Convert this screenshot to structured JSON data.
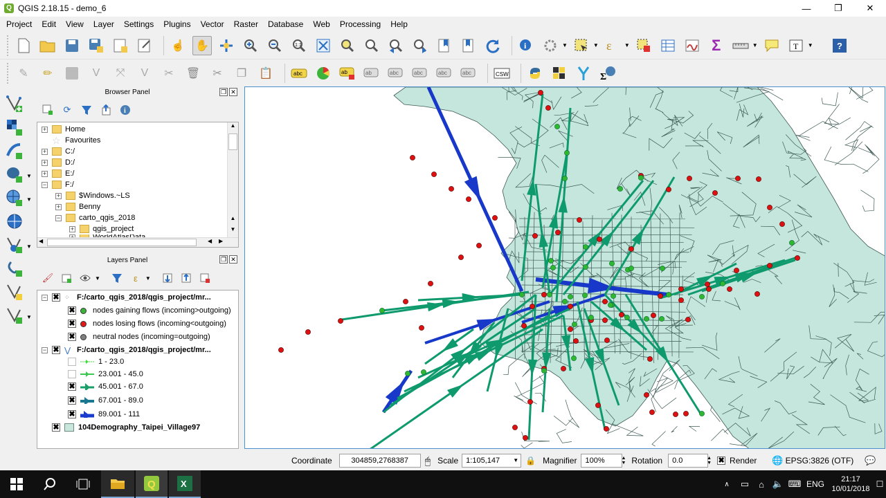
{
  "window": {
    "title": "QGIS 2.18.15 - demo_6",
    "minimize_glyph": "—",
    "maximize_glyph": "❐",
    "close_glyph": "✕"
  },
  "menu": [
    "Project",
    "Edit",
    "View",
    "Layer",
    "Settings",
    "Plugins",
    "Vector",
    "Raster",
    "Database",
    "Web",
    "Processing",
    "Help"
  ],
  "browser_panel": {
    "title": "Browser Panel",
    "items": [
      {
        "label": "Home",
        "type": "folder",
        "expand": "+"
      },
      {
        "label": "Favourites",
        "type": "star",
        "expand": ""
      },
      {
        "label": "C:/",
        "type": "folder",
        "expand": "+"
      },
      {
        "label": "D:/",
        "type": "folder",
        "expand": "+"
      },
      {
        "label": "E:/",
        "type": "folder",
        "expand": "+"
      },
      {
        "label": "F:/",
        "type": "folder",
        "expand": "−"
      },
      {
        "label": "$Windows.~LS",
        "type": "folder",
        "expand": "+"
      },
      {
        "label": "Benny",
        "type": "folder",
        "expand": "+"
      },
      {
        "label": "carto_qgis_2018",
        "type": "folder",
        "expand": "−"
      },
      {
        "label": "qgis_project",
        "type": "folder",
        "expand": "+"
      },
      {
        "label": "WorldAtlasData",
        "type": "folder",
        "expand": "+"
      }
    ]
  },
  "layers_panel": {
    "title": "Layers Panel",
    "layer1": {
      "name": "F:/carto_qgis_2018/qgis_project/mr...",
      "classes": [
        {
          "label": "nodes gaining flows (incoming>outgoing)",
          "color": "#3cb43c",
          "checked": "✖"
        },
        {
          "label": "nodes losing flows (incoming<outgoing)",
          "color": "#e01818",
          "checked": "✖"
        },
        {
          "label": "neutral nodes (incoming=outgoing)",
          "color": "#7f7f7f",
          "checked": "✖"
        }
      ]
    },
    "layer2": {
      "name": "F:/carto_qgis_2018/qgis_project/mr...",
      "classes": [
        {
          "label": "1 - 23.0",
          "color": "#3cdc3c",
          "checked": ""
        },
        {
          "label": "23.001 - 45.0",
          "color": "#3cc850",
          "checked": ""
        },
        {
          "label": "45.001 - 67.0",
          "color": "#1a9e6a",
          "checked": "✖"
        },
        {
          "label": "67.001 - 89.0",
          "color": "#1a7890",
          "checked": "✖"
        },
        {
          "label": "89.001 - 111",
          "color": "#1a3ccc",
          "checked": "✖"
        }
      ]
    },
    "layer3": {
      "name": "104Demography_Taipei_Village97",
      "color": "#c8e6dc",
      "checked": "✖"
    }
  },
  "statusbar": {
    "coordinate_label": "Coordinate",
    "coordinate_value": "304859,2768387",
    "scale_label": "Scale",
    "scale_value": "1:105,147",
    "magnifier_label": "Magnifier",
    "magnifier_value": "100%",
    "rotation_label": "Rotation",
    "rotation_value": "0.0",
    "render_label": "Render",
    "crs_label": "EPSG:3826 (OTF)"
  },
  "taskbar": {
    "time": "21:17",
    "date": "10/01/2018",
    "lang": "ENG"
  },
  "map_colors": {
    "land": "#c4e6dc",
    "boundary": "#3d5a54",
    "flow_green": "#0f9a6e",
    "flow_blue": "#1738c8",
    "node_red": "#e01010",
    "node_green": "#2fb82f"
  }
}
